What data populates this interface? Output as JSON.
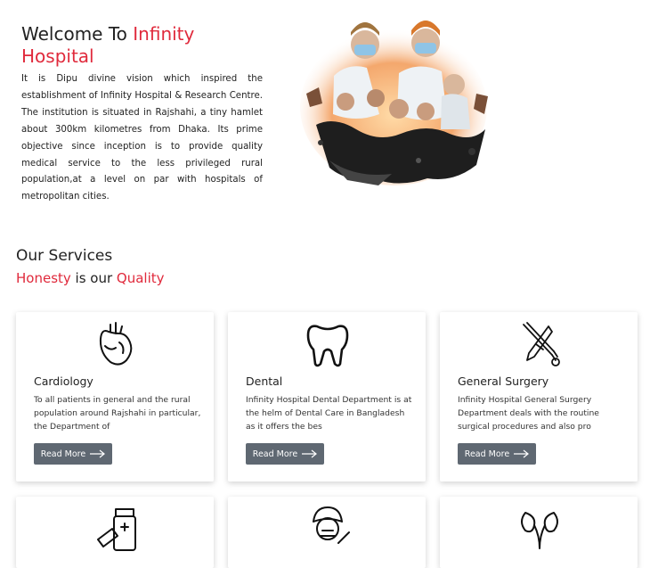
{
  "intro": {
    "title_prefix": "Welcome To ",
    "title_highlight": "Infinity Hospital",
    "description": "It is Dipu divine vision which inspired the establishment of Infinity Hospital & Research Centre. The institution is situated in Rajshahi, a tiny hamlet about 300km kilometres from Dhaka. Its prime objective since inception is to provide quality medical service to the less privileged rural population,at a level on par with hospitals of metropolitan cities."
  },
  "services": {
    "heading": "Our Services",
    "tagline_highlight1": "Honesty",
    "tagline_middle": " is our ",
    "tagline_highlight2": "Quality",
    "cards": [
      {
        "title": "Cardiology",
        "description": "To all patients in general and the rural population around Rajshahi in particular, the Department of",
        "button_label": "Read More",
        "icon": "heart-icon"
      },
      {
        "title": "Dental",
        "description": "Infinity Hospital Dental Department is at the helm of Dental Care in Bangladesh as it offers the bes",
        "button_label": "Read More",
        "icon": "tooth-icon"
      },
      {
        "title": "General Surgery",
        "description": "Infinity Hospital General Surgery Department deals with the routine surgical procedures and also pro",
        "button_label": "Read More",
        "icon": "surgical-tools-icon"
      }
    ],
    "partial_cards": [
      {
        "icon": "medicine-bottle-icon"
      },
      {
        "icon": "nurse-icon"
      },
      {
        "icon": "kidney-icon"
      }
    ]
  },
  "colors": {
    "accent": "#e02a3c",
    "button": "#5f6872"
  }
}
